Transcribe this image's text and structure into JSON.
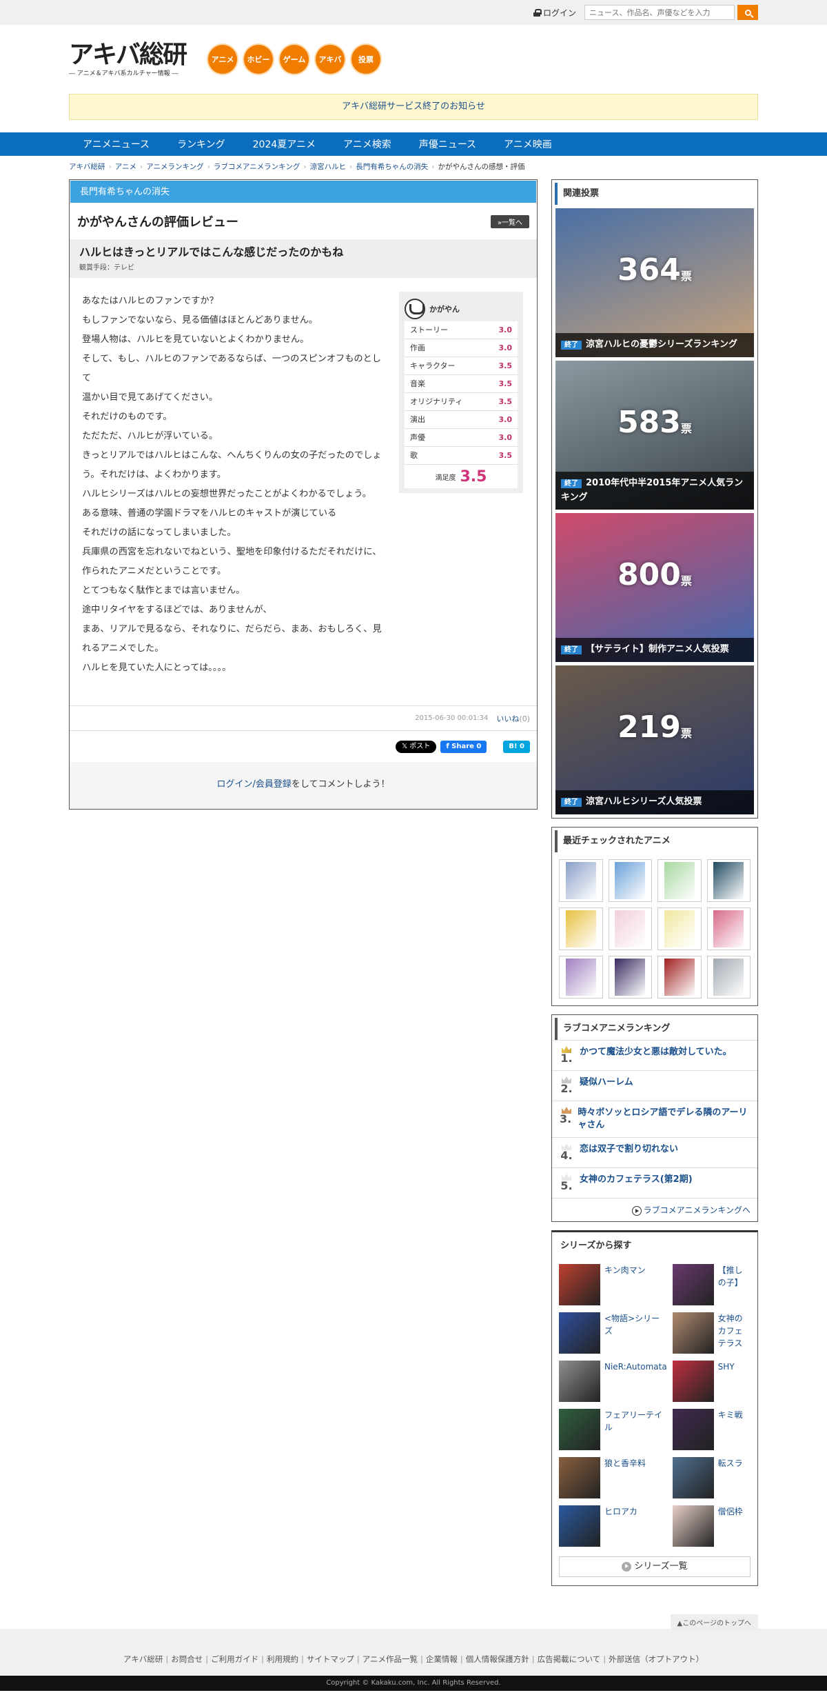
{
  "topbar": {
    "login": "ログイン",
    "search_placeholder": "ニュース、作品名、声優などを入力"
  },
  "logo": {
    "main": "アキバ総研",
    "sub": "― アニメ＆アキバ系カルチャー情報 ―"
  },
  "circles": [
    "アニメ",
    "ホビー",
    "ゲーム",
    "アキバ",
    "投票"
  ],
  "notice": "アキバ総研サービス終了のお知らせ",
  "nav": [
    "アニメニュース",
    "ランキング",
    "2024夏アニメ",
    "アニメ検索",
    "声優ニュース",
    "アニメ映画"
  ],
  "breadcrumb": [
    "アキバ総研",
    "アニメ",
    "アニメランキング",
    "ラブコメアニメランキング",
    "涼宮ハルヒ",
    "長門有希ちゃんの消失",
    "かがやんさんの感想・評価"
  ],
  "review": {
    "category": "長門有希ちゃんの消失",
    "title": "かがやんさんの評価レビュー",
    "back": "»一覧へ",
    "headline": "ハルヒはきっとリアルではこんな感じだったのかもね",
    "method": "観賞手段：テレビ",
    "body": [
      "あなたはハルヒのファンですか？",
      "もしファンでないなら、見る価値はほとんどありません。",
      "登場人物は、ハルヒを見ていないとよくわかりません。",
      "そして、もし、ハルヒのファンであるならば、一つのスピンオフものとして",
      "温かい目で見てあげてください。",
      "それだけのものです。",
      "ただただ、ハルヒが浮いている。",
      "きっとリアルではハルヒはこんな、へんちくりんの女の子だったのでしょう。それだけは、よくわかります。",
      "ハルヒシリーズはハルヒの妄想世界だったことがよくわかるでしょう。",
      "ある意味、普通の学園ドラマをハルヒのキャストが演じている",
      "それだけの話になってしまいました。",
      "兵庫県の西宮を忘れないでねという、聖地を印象付けるただそれだけに、作られたアニメだということです。",
      "とてつもなく駄作とまでは言いません。",
      "途中リタイヤをするほどでは、ありませんが、",
      "まあ、リアルで見るなら、それなりに、だらだら、まあ、おもしろく、見れるアニメでした。",
      "ハルヒを見ていた人にとっては。。。。"
    ],
    "user": "かがやん",
    "scores": [
      {
        "k": "ストーリー",
        "v": "3.0"
      },
      {
        "k": "作画",
        "v": "3.0"
      },
      {
        "k": "キャラクター",
        "v": "3.5"
      },
      {
        "k": "音楽",
        "v": "3.5"
      },
      {
        "k": "オリジナリティ",
        "v": "3.5"
      },
      {
        "k": "演出",
        "v": "3.0"
      },
      {
        "k": "声優",
        "v": "3.0"
      },
      {
        "k": "歌",
        "v": "3.5"
      }
    ],
    "satisfaction_label": "満足度",
    "satisfaction": "3.5",
    "date": "2015-06-30 00:01:34",
    "like": "いいね",
    "like_count": "(0)",
    "x_post": "𝕏 ポスト",
    "fb_share": "f Share 0",
    "hatena": "B! 0",
    "comment_link": "ログイン/会員登録",
    "comment_text": "をしてコメントしよう！"
  },
  "sidebar": {
    "votes_title": "関連投票",
    "votes": [
      {
        "num": "364",
        "unit": "票",
        "end": "終了",
        "title": "涼宮ハルヒの憂鬱シリーズランキング",
        "c1": "#4a6fa5",
        "c2": "#c9a37a"
      },
      {
        "num": "583",
        "unit": "票",
        "end": "終了",
        "title": "2010年代中半2015年アニメ人気ランキング",
        "c1": "#8a9aa0",
        "c2": "#3a4048"
      },
      {
        "num": "800",
        "unit": "票",
        "end": "終了",
        "title": "【サテライト】制作アニメ人気投票",
        "c1": "#d04a6a",
        "c2": "#3a6ab0"
      },
      {
        "num": "219",
        "unit": "票",
        "end": "終了",
        "title": "涼宮ハルヒシリーズ人気投票",
        "c1": "#6a5a4a",
        "c2": "#2a3a6a"
      }
    ],
    "recent_title": "最近チェックされたアニメ",
    "recent_colors": [
      "#8aa0c8",
      "#6aa0d8",
      "#a8d8a0",
      "#204a60",
      "#e8c040",
      "#f0d0d8",
      "#f0e8a0",
      "#d86a8a",
      "#a080c0",
      "#3a2a60",
      "#a02020",
      "#a0a8b0"
    ],
    "ranking_title": "ラブコメアニメランキング",
    "ranking": [
      {
        "n": "1.",
        "t": "かつて魔法少女と悪は敵対していた。"
      },
      {
        "n": "2.",
        "t": "疑似ハーレム"
      },
      {
        "n": "3.",
        "t": "時々ボソッとロシア語でデレる隣のアーリャさん"
      },
      {
        "n": "4.",
        "t": "恋は双子で割り切れない"
      },
      {
        "n": "5.",
        "t": "女神のカフェテラス(第2期)"
      }
    ],
    "ranking_more": "ラブコメアニメランキングへ",
    "series_title": "シリーズから探す",
    "series": [
      {
        "n": "キン肉マン",
        "c": "#c04030"
      },
      {
        "n": "【推しの子】",
        "c": "#6a3a70"
      },
      {
        "n": "<物語>シリーズ",
        "c": "#3050a0"
      },
      {
        "n": "女神のカフェテラス",
        "c": "#b08a70"
      },
      {
        "n": "NieR:Automata",
        "c": "#909090"
      },
      {
        "n": "SHY",
        "c": "#c03040"
      },
      {
        "n": "フェアリーテイル",
        "c": "#306040"
      },
      {
        "n": "キミ戦",
        "c": "#402a50"
      },
      {
        "n": "狼と香辛料",
        "c": "#8a6040"
      },
      {
        "n": "転スラ",
        "c": "#507090"
      },
      {
        "n": "ヒロアカ",
        "c": "#2a5aa0"
      },
      {
        "n": "僧侶枠",
        "c": "#e8d0c8"
      }
    ],
    "series_more": "シリーズ一覧"
  },
  "pagetop": "▲このページのトップへ",
  "footer": [
    "アキバ総研",
    "お問合せ",
    "ご利用ガイド",
    "利用規約",
    "サイトマップ",
    "アニメ作品一覧",
    "企業情報",
    "個人情報保護方針",
    "広告掲載について",
    "外部送信（オプトアウト）"
  ],
  "copyright": "Copyright © Kakaku.com, Inc. All Rights Reserved."
}
